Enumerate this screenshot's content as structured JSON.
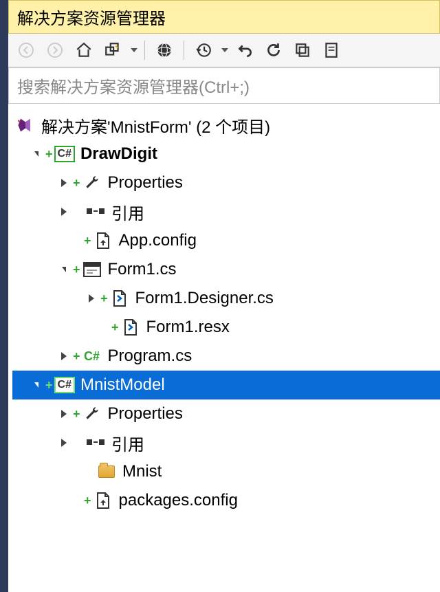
{
  "panel": {
    "title": "解决方案资源管理器",
    "search_placeholder": "搜索解决方案资源管理器(Ctrl+;)"
  },
  "toolbar": {
    "back": "back",
    "forward": "forward",
    "home": "home",
    "sync": "sync-with-active-document",
    "globe": "show-all-files",
    "history": "pending-changes",
    "refresh": "refresh",
    "redo": "redo",
    "collapse": "collapse-all",
    "properties": "properties"
  },
  "tree": {
    "solution": "解决方案'MnistForm' (2 个项目)",
    "project1": {
      "name": "DrawDigit",
      "properties": "Properties",
      "references": "引用",
      "appconfig": "App.config",
      "form1": "Form1.cs",
      "form1designer": "Form1.Designer.cs",
      "form1resx": "Form1.resx",
      "program": "Program.cs"
    },
    "project2": {
      "name": "MnistModel",
      "properties": "Properties",
      "references": "引用",
      "mnist": "Mnist",
      "packages": "packages.config"
    }
  }
}
